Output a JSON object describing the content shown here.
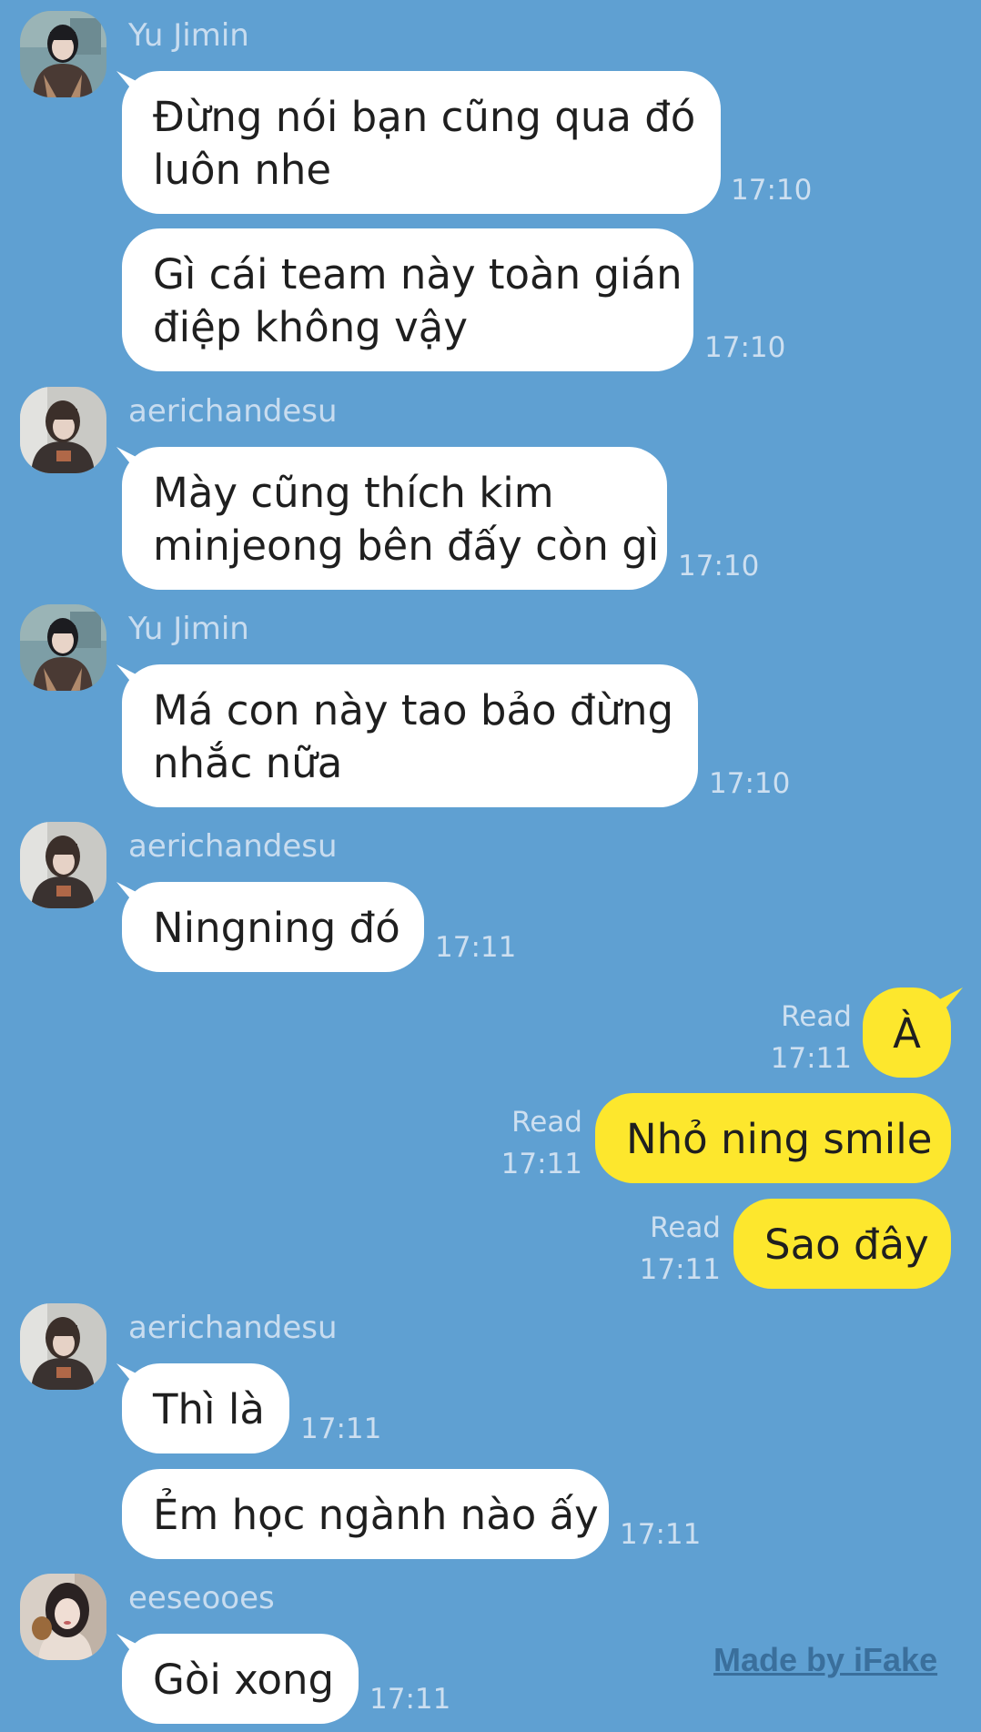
{
  "messages": [
    {
      "sender": "Yu Jimin",
      "text": "Đừng nói bạn cũng qua đó\nluôn nhe",
      "time": "17:10"
    },
    {
      "text": "Gì cái team này toàn gián\nđiệp không vậy",
      "time": "17:10"
    },
    {
      "sender": "aerichandesu",
      "text": "Mày cũng thích kim\nminjeong bên đấy còn gì",
      "time": "17:10"
    },
    {
      "sender": "Yu Jimin",
      "text": "Má con này tao bảo đừng\nnhắc nữa",
      "time": "17:10"
    },
    {
      "sender": "aerichandesu",
      "text": "Ningning đó",
      "time": "17:11"
    },
    {
      "text": "À",
      "read": "Read",
      "time": "17:11"
    },
    {
      "text": "Nhỏ ning smile",
      "read": "Read",
      "time": "17:11"
    },
    {
      "text": "Sao đây",
      "read": "Read",
      "time": "17:11"
    },
    {
      "sender": "aerichandesu",
      "text": "Thì là",
      "time": "17:11"
    },
    {
      "text": "Ẻm học ngành nào ấy",
      "time": "17:11"
    },
    {
      "sender": "eeseooes",
      "text": "Gòi xong",
      "time": "17:11"
    }
  ],
  "watermark": "Made by iFake",
  "colors": {
    "background": "#5fa0d2",
    "incoming_bubble": "#ffffff",
    "outgoing_bubble": "#fde72d"
  },
  "icons": {
    "avatar_yu_jimin": "avatar-yu-jimin",
    "avatar_aerichandesu": "avatar-aerichandesu",
    "avatar_eeseooes": "avatar-eeseooes"
  }
}
